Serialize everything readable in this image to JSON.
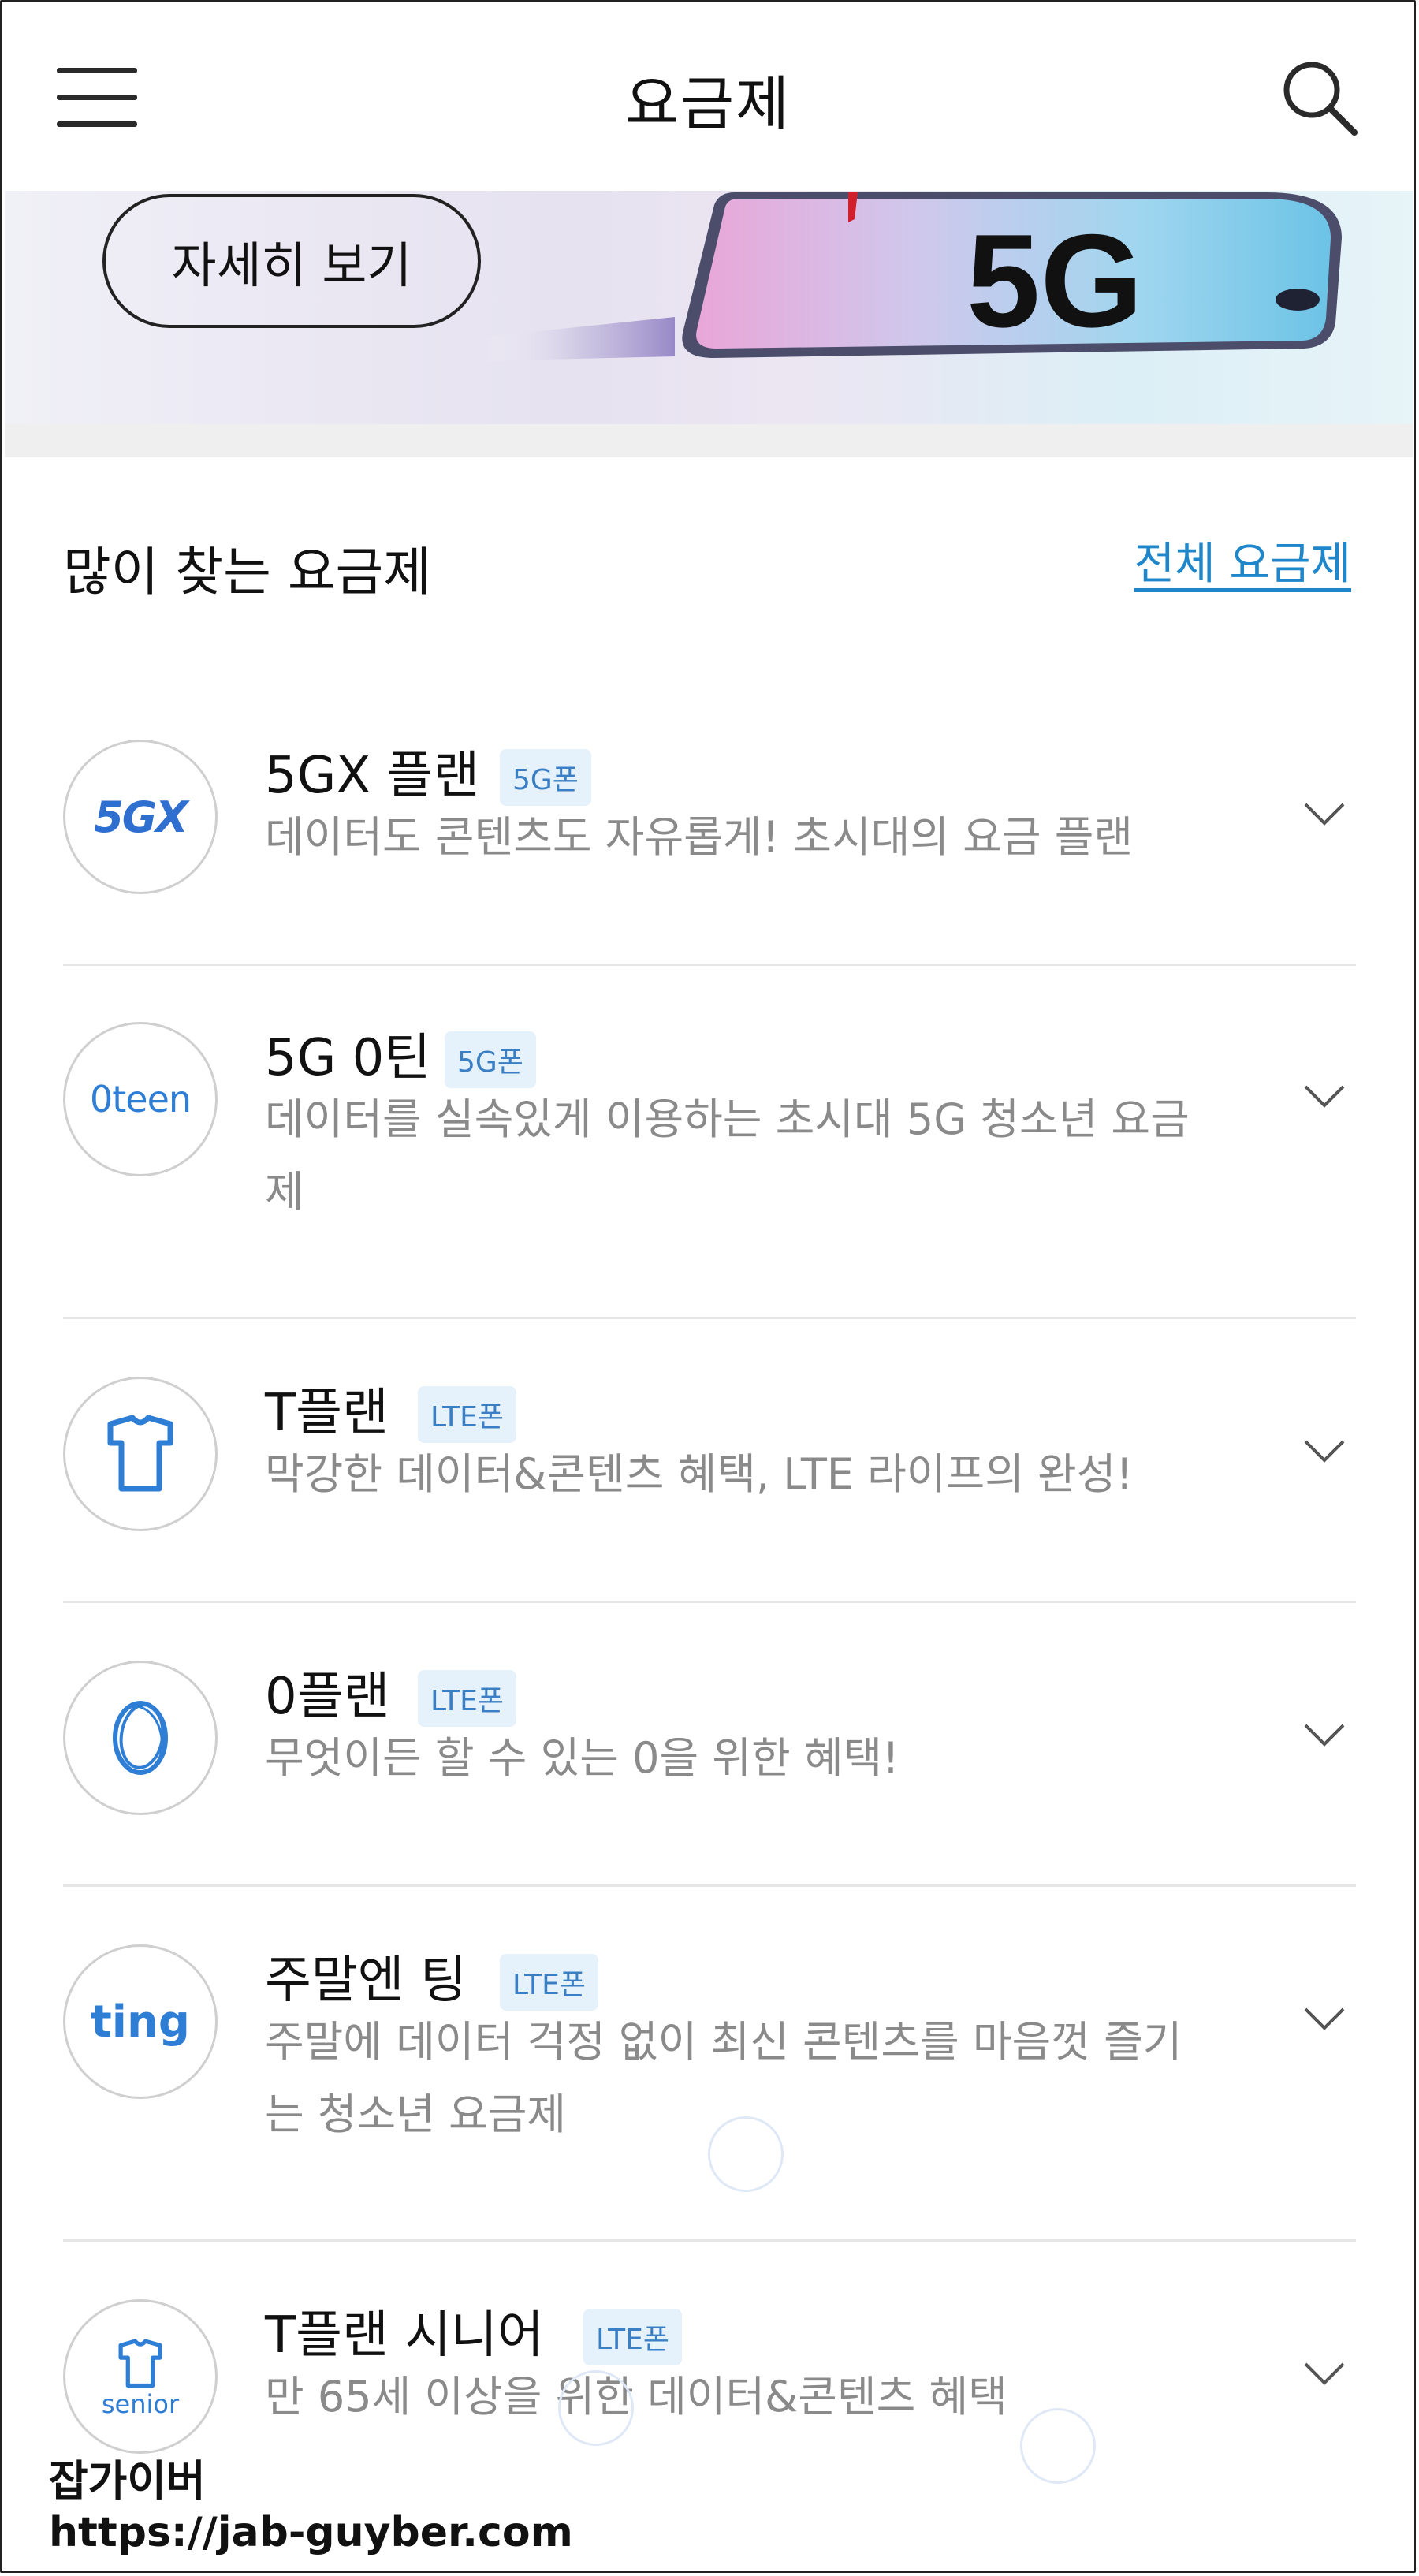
{
  "header": {
    "title": "요금제"
  },
  "banner": {
    "button_label": "자세히 보기",
    "brand_text": "5G"
  },
  "section": {
    "title": "많이 찾는 요금제",
    "all_link": "전체 요금제"
  },
  "plans": [
    {
      "name": "5GX 플랜",
      "badge": "5G폰",
      "desc": "데이터도 콘텐츠도 자유롭게! 초시대의 요금 플랜",
      "logo_text": "5GX"
    },
    {
      "name": "5G 0틴",
      "badge": "5G폰",
      "desc": "데이터를 실속있게 이용하는 초시대 5G 청소년 요금제",
      "logo_text": "0teen"
    },
    {
      "name": "T플랜",
      "badge": "LTE폰",
      "desc": "막강한 데이터&콘텐츠 혜택, LTE 라이프의 완성!",
      "logo_text": ""
    },
    {
      "name": "0플랜",
      "badge": "LTE폰",
      "desc": "무엇이든 할 수 있는 0을 위한 혜택!",
      "logo_text": ""
    },
    {
      "name": "주말엔 팅",
      "badge": "LTE폰",
      "desc": "주말에 데이터 걱정 없이 최신 콘텐츠를 마음껏 즐기는 청소년 요금제",
      "logo_text": "ting"
    },
    {
      "name": "T플랜 시니어",
      "badge": "LTE폰",
      "desc": "만 65세 이상을 위한 데이터&콘텐츠 혜택",
      "logo_text": "senior"
    }
  ],
  "watermark": {
    "name": "잡가이버",
    "url": "https://jab-guyber.com"
  },
  "colors": {
    "accent": "#1f86c9",
    "badge_bg": "#e5f1fb",
    "badge_text": "#3a7fc4",
    "logo_blue": "#2f7ed6"
  }
}
